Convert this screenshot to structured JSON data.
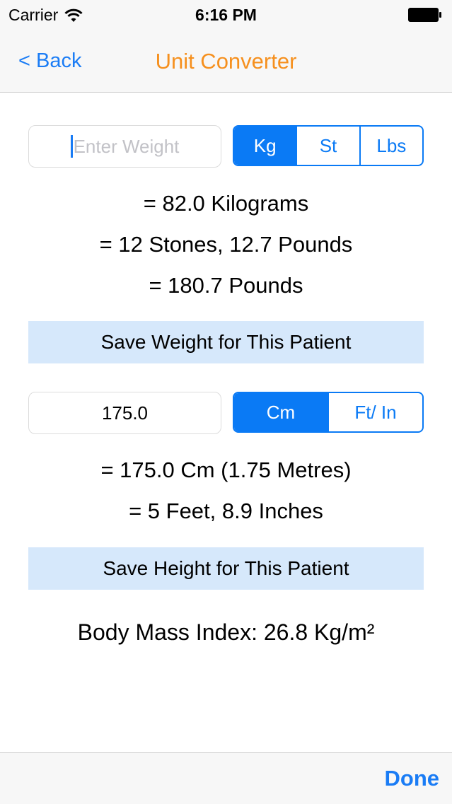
{
  "status": {
    "carrier": "Carrier",
    "time": "6:16 PM"
  },
  "nav": {
    "back_label": "< Back",
    "title": "Unit Converter"
  },
  "weight": {
    "input_placeholder": "Enter Weight",
    "units": [
      "Kg",
      "St",
      "Lbs"
    ],
    "selected_unit": "Kg",
    "results": [
      "= 82.0 Kilograms",
      "= 12 Stones, 12.7 Pounds",
      "= 180.7 Pounds"
    ],
    "save_label": "Save Weight for This Patient"
  },
  "height": {
    "input_value": "175.0",
    "units": [
      "Cm",
      "Ft/ In"
    ],
    "selected_unit": "Cm",
    "results": [
      "= 175.0 Cm (1.75 Metres)",
      "= 5 Feet, 8.9 Inches"
    ],
    "save_label": "Save Height for This Patient"
  },
  "bmi": {
    "text": "Body Mass Index: 26.8 Kg/m²"
  },
  "toolbar": {
    "done_label": "Done"
  },
  "colors": {
    "accent": "#0a7af5",
    "title": "#f6901e",
    "save_button_bg": "#d6e8fb"
  }
}
